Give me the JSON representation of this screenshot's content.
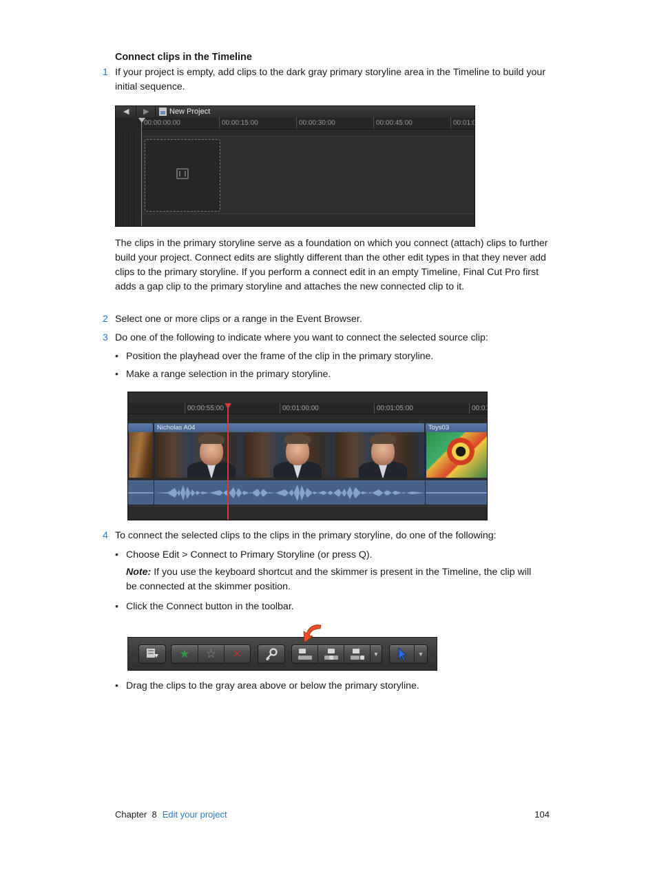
{
  "heading": "Connect clips in the Timeline",
  "steps": [
    {
      "num": "1",
      "text": "If your project is empty, add clips to the dark gray primary storyline area in the Timeline to build your initial sequence."
    },
    {
      "num": "2",
      "text": "Select one or more clips or a range in the Event Browser."
    },
    {
      "num": "3",
      "text": "Do one of the following to indicate where you want to connect the selected source clip:"
    },
    {
      "num": "4",
      "text": "To connect the selected clips to the clips in the primary storyline, do one of the following:"
    }
  ],
  "paragraph": " The clips in the primary storyline serve as a foundation on which you connect (attach) clips to further build your project. Connect edits are slightly different than the other edit types in that they never add clips to the primary storyline. If you perform a connect edit in an empty Timeline, Final Cut Pro first adds a gap clip to the primary storyline and attaches the new connected clip to it.",
  "step3_bullets": [
    "Position the playhead over the frame of the clip in the primary storyline.",
    "Make a range selection in the primary storyline."
  ],
  "step4_bullets": [
    "Choose Edit > Connect to Primary Storyline (or press Q).",
    "Click the Connect button in the toolbar.",
    "Drag the clips to the gray area above or below the primary storyline."
  ],
  "note": {
    "label": "Note:",
    "text": "If you use the keyboard shortcut and the skimmer is present in the Timeline, the clip will be connected at the skimmer position."
  },
  "bullet_glyph": "•",
  "timeline_empty": {
    "back_glyph": "◀",
    "forward_glyph": "▶",
    "project_name": "New Project",
    "ruler": [
      "00:00:00:00",
      "00:00:15:00",
      "00:00:30:00",
      "00:00:45:00",
      "00:01:0"
    ]
  },
  "timeline_clips": {
    "ruler": [
      "00:00:55:00",
      "00:01:00:00",
      "00:01:05:00",
      "00:01"
    ],
    "clips": [
      "Nicholas A04",
      "Toys03"
    ],
    "playhead_color": "#d23c3c",
    "clip_color": "#4f6e99"
  },
  "toolbar": {
    "icons": [
      "import-icon",
      "favorite-icon",
      "unrate-icon",
      "reject-icon",
      "keyword-icon",
      "connect-icon",
      "insert-icon",
      "append-icon",
      "edit-menu-chevron-icon",
      "select-tool-icon",
      "tool-menu-chevron-icon"
    ],
    "glyphs": {
      "favorite": "★",
      "unrate": "☆",
      "reject": "✕",
      "chevron": "▼"
    },
    "highlight_color": "#e8502a"
  },
  "footer": {
    "chapter": "Chapter  8",
    "chapter_title": "Edit your project",
    "page": "104"
  }
}
